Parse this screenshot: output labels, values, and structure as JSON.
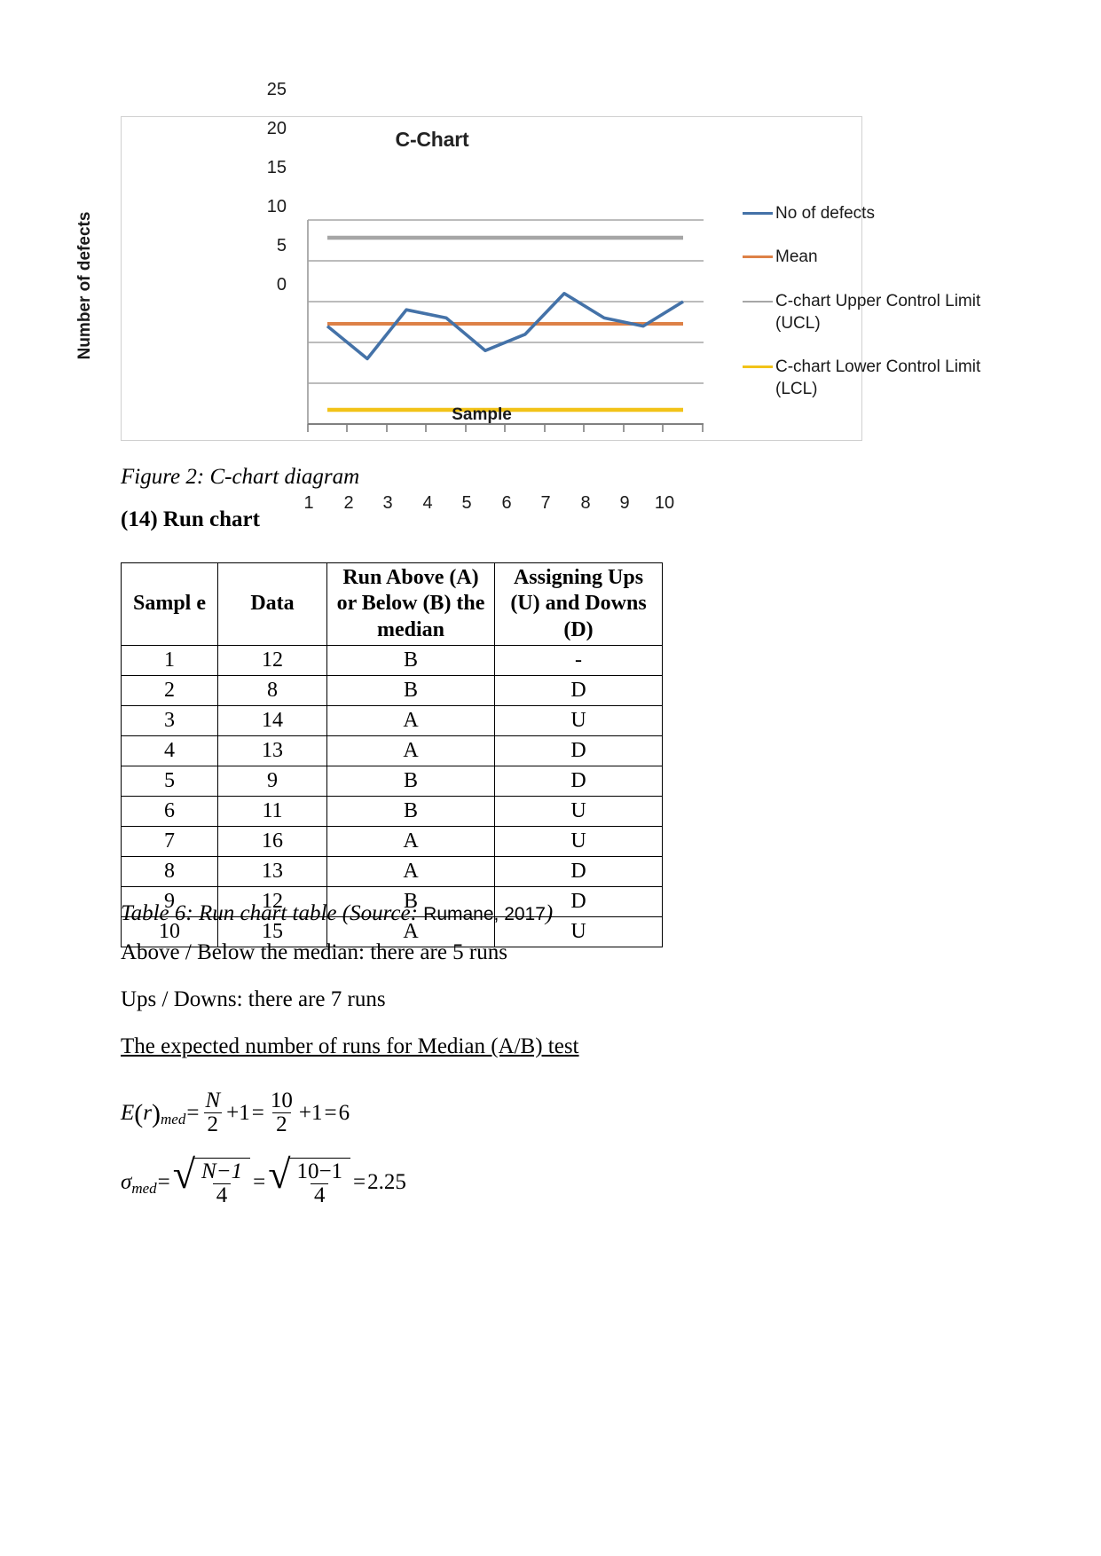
{
  "chart": {
    "title": "C-Chart",
    "legend": [
      {
        "label": "No of defects",
        "color": "#4472a8"
      },
      {
        "label": "Mean",
        "color": "#dd8147"
      },
      {
        "label": "C-chart Upper Control Limit (UCL)",
        "color": "#a6a6a6"
      },
      {
        "label": "C-chart Lower Control Limit (LCL)",
        "color": "#f2c318"
      }
    ]
  },
  "chart_data": {
    "type": "line",
    "title": "C-Chart",
    "xlabel": "Sample",
    "ylabel": "Number of defects",
    "x": [
      1,
      2,
      3,
      4,
      5,
      6,
      7,
      8,
      9,
      10
    ],
    "xtick_labels": [
      "1",
      "2",
      "3",
      "4",
      "5",
      "6",
      "7",
      "8",
      "9",
      "10"
    ],
    "ytick_labels": [
      "0",
      "5",
      "10",
      "15",
      "20",
      "25"
    ],
    "ylim": [
      0,
      25
    ],
    "ytick_step": 5,
    "grid": true,
    "legend_position": "right",
    "series": [
      {
        "name": "No of defects",
        "color": "#4472a8",
        "values": [
          12,
          8,
          14,
          13,
          9,
          11,
          16,
          13,
          12,
          15
        ]
      },
      {
        "name": "Mean",
        "color": "#dd8147",
        "values": [
          12.3,
          12.3,
          12.3,
          12.3,
          12.3,
          12.3,
          12.3,
          12.3,
          12.3,
          12.3
        ]
      },
      {
        "name": "C-chart Upper Control Limit (UCL)",
        "color": "#a6a6a6",
        "values": [
          22.8,
          22.8,
          22.8,
          22.8,
          22.8,
          22.8,
          22.8,
          22.8,
          22.8,
          22.8
        ]
      },
      {
        "name": "C-chart Lower Control Limit (LCL)",
        "color": "#f2c318",
        "values": [
          1.7,
          1.7,
          1.7,
          1.7,
          1.7,
          1.7,
          1.7,
          1.7,
          1.7,
          1.7
        ]
      }
    ]
  },
  "figure_caption": "Figure 2: C-chart diagram",
  "section_heading": "(14) Run chart",
  "table": {
    "headers": [
      "Sampl e",
      "Data",
      "Run Above (A) or Below (B) the median",
      "Assigning Ups (U) and Downs (D)"
    ],
    "rows": [
      [
        "1",
        "12",
        "B",
        "-"
      ],
      [
        "2",
        "8",
        "B",
        "D"
      ],
      [
        "3",
        "14",
        "A",
        "U"
      ],
      [
        "4",
        "13",
        "A",
        "D"
      ],
      [
        "5",
        "9",
        "B",
        "D"
      ],
      [
        "6",
        "11",
        "B",
        "U"
      ],
      [
        "7",
        "16",
        "A",
        "U"
      ],
      [
        "8",
        "13",
        "A",
        "D"
      ],
      [
        "9",
        "12",
        "B",
        "D"
      ],
      [
        "10",
        "15",
        "A",
        "U"
      ]
    ]
  },
  "table_caption": {
    "main": "Table 6: Run chart table (Source: ",
    "source": "Rumane, 2017",
    "tail": ")"
  },
  "paragraphs": {
    "above_below": "Above / Below the median: there are 5 runs",
    "ups_downs": "Ups / Downs: there are 7 runs",
    "expected_heading": "The expected number of runs for Median (A/B) test"
  },
  "formulas": {
    "expected_runs": {
      "lhs_E": "E",
      "lhs_r": "r",
      "lhs_sub": "med",
      "eq1": "=",
      "num1": "N",
      "den1": "2",
      "plus1": "+1",
      "eq2": "=",
      "num2": "10",
      "den2": "2",
      "plus2": "+1",
      "eq3": "=",
      "result": "6"
    },
    "sigma": {
      "lhs_sigma": "σ",
      "lhs_sub": "med",
      "eq1": "=",
      "num1": "N−1",
      "den1": "4",
      "eq2": "=",
      "num2": "10−1",
      "den2": "4",
      "eq3": "=",
      "result": "2.25"
    }
  }
}
